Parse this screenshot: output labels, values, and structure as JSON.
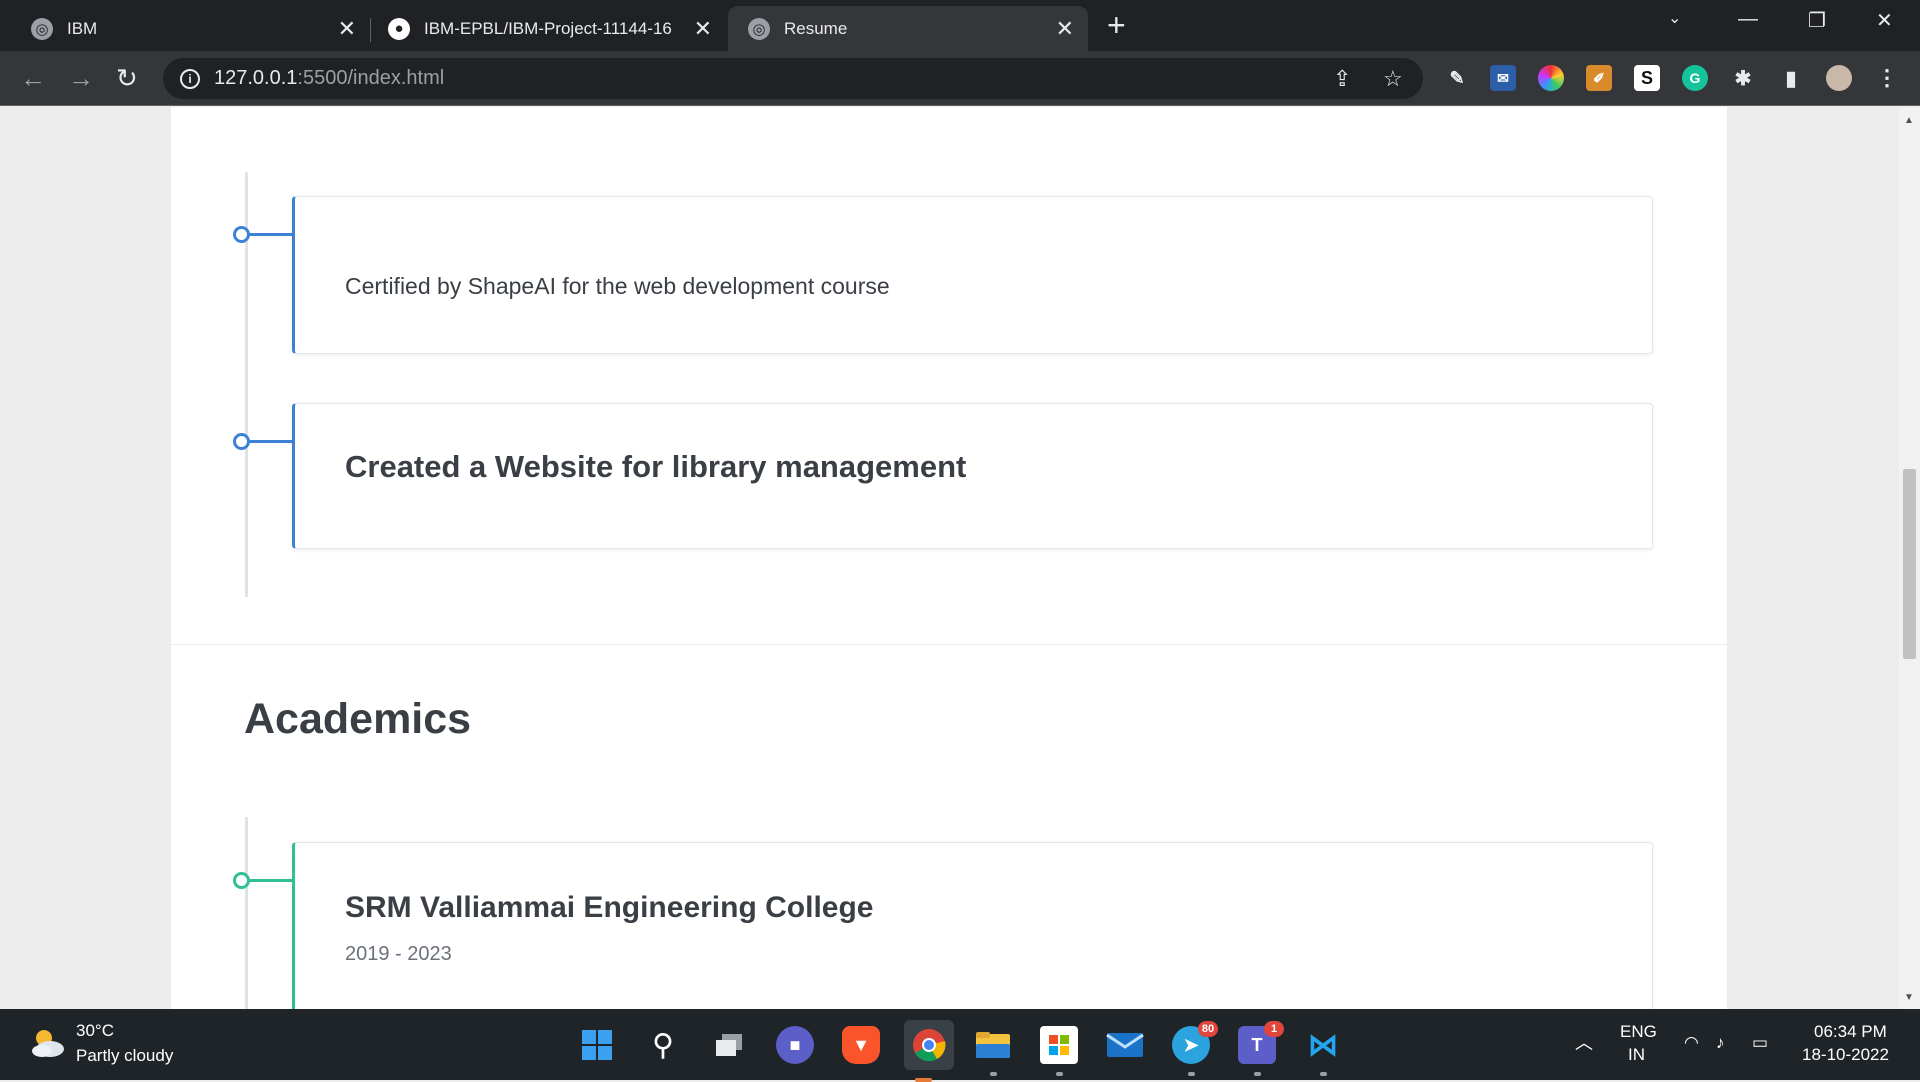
{
  "browser": {
    "tabs": [
      {
        "title": "IBM",
        "icon": "globe-icon",
        "active": false
      },
      {
        "title": "IBM-EPBL/IBM-Project-11144-16",
        "icon": "github-icon",
        "active": false
      },
      {
        "title": "Resume",
        "icon": "globe-icon",
        "active": true
      }
    ],
    "url_host": "127.0.0.1",
    "url_rest": ":5500/index.html"
  },
  "page": {
    "items": [
      {
        "text": "Certified by ShapeAI for the web development course"
      },
      {
        "title": "Created a Website for library management"
      }
    ],
    "academics": {
      "heading": "Academics",
      "entries": [
        {
          "institution": "SRM Valliammai Engineering College",
          "years": "2019 - 2023"
        }
      ]
    }
  },
  "taskbar": {
    "weather": {
      "temp": "30°C",
      "desc": "Partly cloudy",
      "icon": "partly-cloudy-icon"
    },
    "apps": [
      {
        "name": "windows-start",
        "icon": "windows-logo-icon"
      },
      {
        "name": "search",
        "icon": "search-icon"
      },
      {
        "name": "task-view",
        "icon": "task-view-icon"
      },
      {
        "name": "chat",
        "icon": "video-chat-icon"
      },
      {
        "name": "brave",
        "icon": "brave-lion-icon"
      },
      {
        "name": "chrome",
        "icon": "chrome-icon"
      },
      {
        "name": "file-explorer",
        "icon": "folder-icon"
      },
      {
        "name": "microsoft-store",
        "icon": "store-icon"
      },
      {
        "name": "mail",
        "icon": "mail-icon"
      },
      {
        "name": "telegram",
        "icon": "telegram-icon",
        "badge": "80"
      },
      {
        "name": "teams",
        "icon": "teams-icon",
        "badge": "1"
      },
      {
        "name": "vscode",
        "icon": "vscode-icon"
      }
    ],
    "lang_top": "ENG",
    "lang_bottom": "IN",
    "time": "06:34 PM",
    "date": "18-10-2022"
  },
  "colors": {
    "timeline_blue": "#3b82d6",
    "timeline_green": "#2fbf95",
    "chrome_dark": "#202124",
    "chrome_toolbar": "#35363a"
  }
}
